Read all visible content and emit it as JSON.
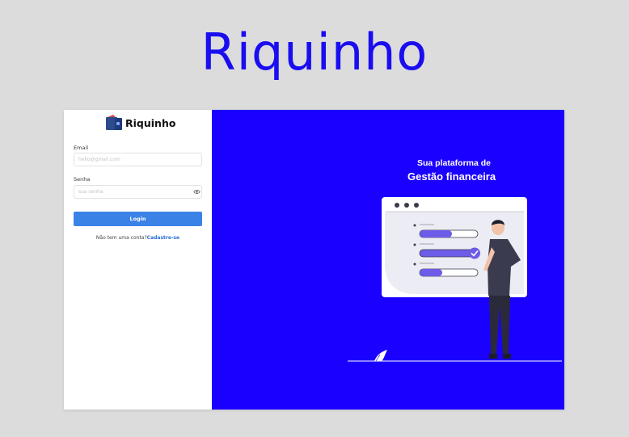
{
  "hero": {
    "title": "Riquinho"
  },
  "brand": {
    "name": "Riquinho"
  },
  "form": {
    "email_label": "Email",
    "email_placeholder": "hello@gmail.com",
    "password_label": "Senha",
    "password_placeholder": "sua senha",
    "login_label": "Login",
    "signup_prompt": "Não tem uma conta?",
    "signup_link": "Cadastre-se"
  },
  "promo": {
    "tagline_small": "Sua plataforma de",
    "tagline_big": "Gestão financeira"
  },
  "icons": {
    "logo": "wallet-icon",
    "password_toggle": "eye-icon",
    "illustration": "person-checklist-illustration"
  },
  "colors": {
    "accent_blue": "#1a00ff",
    "title_blue": "#1a0df0",
    "button_blue": "#3b82e6",
    "link_blue": "#2a6fd6",
    "progress_purple": "#6c5ce7"
  }
}
